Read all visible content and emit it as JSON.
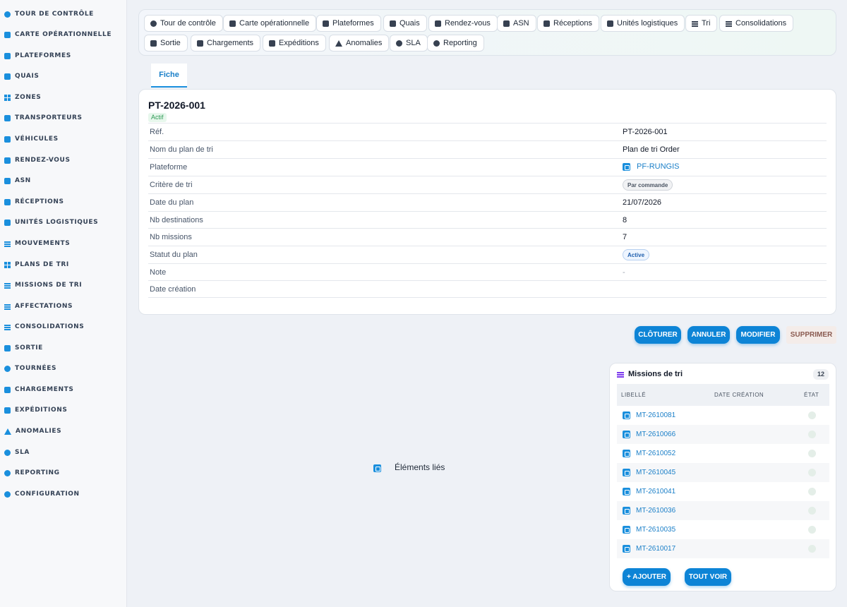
{
  "sidebar": {
    "items": [
      {
        "label": "TOUR DE CONTRÔLE",
        "icon": "gauge-icon"
      },
      {
        "label": "CARTE OPÉRATIONNELLE",
        "icon": "map-icon"
      },
      {
        "label": "PLATEFORMES",
        "icon": "warehouse-icon"
      },
      {
        "label": "QUAIS",
        "icon": "dock-icon"
      },
      {
        "label": "ZONES",
        "icon": "grid-icon"
      },
      {
        "label": "TRANSPORTEURS",
        "icon": "truck-icon"
      },
      {
        "label": "VÉHICULES",
        "icon": "van-icon"
      },
      {
        "label": "RENDEZ-VOUS",
        "icon": "calendar-icon"
      },
      {
        "label": "ASN",
        "icon": "document-icon"
      },
      {
        "label": "RÉCEPTIONS",
        "icon": "receive-icon"
      },
      {
        "label": "UNITÉS LOGISTIQUES",
        "icon": "pallet-icon"
      },
      {
        "label": "MOUVEMENTS",
        "icon": "arrows-icon"
      },
      {
        "label": "PLANS DE TRI",
        "icon": "sitemap-icon"
      },
      {
        "label": "MISSIONS DE TRI",
        "icon": "list-icon"
      },
      {
        "label": "AFFECTATIONS",
        "icon": "shuffle-icon"
      },
      {
        "label": "CONSOLIDATIONS",
        "icon": "layers-icon"
      },
      {
        "label": "SORTIE",
        "icon": "exit-icon"
      },
      {
        "label": "TOURNÉES",
        "icon": "route-icon"
      },
      {
        "label": "CHARGEMENTS",
        "icon": "loading-icon"
      },
      {
        "label": "EXPÉDITIONS",
        "icon": "shipping-icon"
      },
      {
        "label": "ANOMALIES",
        "icon": "warning-icon"
      },
      {
        "label": "SLA",
        "icon": "stopwatch-icon"
      },
      {
        "label": "REPORTING",
        "icon": "chart-pie-icon"
      },
      {
        "label": "CONFIGURATION",
        "icon": "gear-icon"
      }
    ]
  },
  "topnav": {
    "chips": [
      {
        "label": "Tour de contrôle",
        "icon": "gauge-icon"
      },
      {
        "label": "Carte opérationnelle",
        "icon": "map-icon"
      },
      {
        "label": "Plateformes",
        "icon": "warehouse-icon"
      },
      {
        "label": "Quais",
        "icon": "dock-icon"
      },
      {
        "label": "Rendez-vous",
        "icon": "calendar-icon"
      },
      {
        "label": "ASN",
        "icon": "document-icon"
      },
      {
        "label": "Réceptions",
        "icon": "receive-icon"
      },
      {
        "label": "Unités logistiques",
        "icon": "pallet-icon"
      },
      {
        "label": "Tri",
        "icon": "list-icon"
      },
      {
        "label": "Consolidations",
        "icon": "layers-icon"
      },
      {
        "label": "Sortie",
        "icon": "exit-icon"
      },
      {
        "label": "Chargements",
        "icon": "loading-icon"
      },
      {
        "label": "Expéditions",
        "icon": "shipping-icon"
      },
      {
        "label": "Anomalies",
        "icon": "warning-icon"
      },
      {
        "label": "SLA",
        "icon": "stopwatch-icon"
      },
      {
        "label": "Reporting",
        "icon": "chart-pie-icon"
      }
    ]
  },
  "tabs": {
    "fiche": "Fiche"
  },
  "fiche": {
    "title": "PT-2026-001",
    "status_badge": "Actif",
    "fields": [
      {
        "label": "Réf.",
        "value": "PT-2026-001"
      },
      {
        "label": "Nom du plan de tri",
        "value": "Plan de tri Order"
      },
      {
        "label": "Plateforme",
        "value": "PF-RUNGIS"
      },
      {
        "label": "Critère de tri",
        "value": "Par commande"
      },
      {
        "label": "Date du plan",
        "value": "21/07/2026"
      },
      {
        "label": "Nb destinations",
        "value": "8"
      },
      {
        "label": "Nb missions",
        "value": "7"
      },
      {
        "label": "Statut du plan",
        "value": "Active"
      },
      {
        "label": "Note",
        "value": "-"
      },
      {
        "label": "Date création",
        "value": ""
      }
    ]
  },
  "actions": {
    "cloturer": "CLÔTURER",
    "annuler": "ANNULER",
    "modifier": "MODIFIER",
    "supprimer": "SUPPRIMER"
  },
  "linked": {
    "label": "Éléments liés"
  },
  "missions": {
    "title": "Missions de tri",
    "count": "12",
    "columns": {
      "libelle": "LIBELLÉ",
      "date": "DATE CRÉATION",
      "etat": "ÉTAT"
    },
    "rows": [
      {
        "label": "MT-2610081"
      },
      {
        "label": "MT-2610066"
      },
      {
        "label": "MT-2610052"
      },
      {
        "label": "MT-2610045"
      },
      {
        "label": "MT-2610041"
      },
      {
        "label": "MT-2610036"
      },
      {
        "label": "MT-2610035"
      },
      {
        "label": "MT-2610017"
      }
    ],
    "add_label": "+ AJOUTER",
    "view_all_label": "TOUT VOIR"
  },
  "colors": {
    "accent": "#0d84d6",
    "link": "#1a7fc8",
    "success": "#2e9a55"
  }
}
